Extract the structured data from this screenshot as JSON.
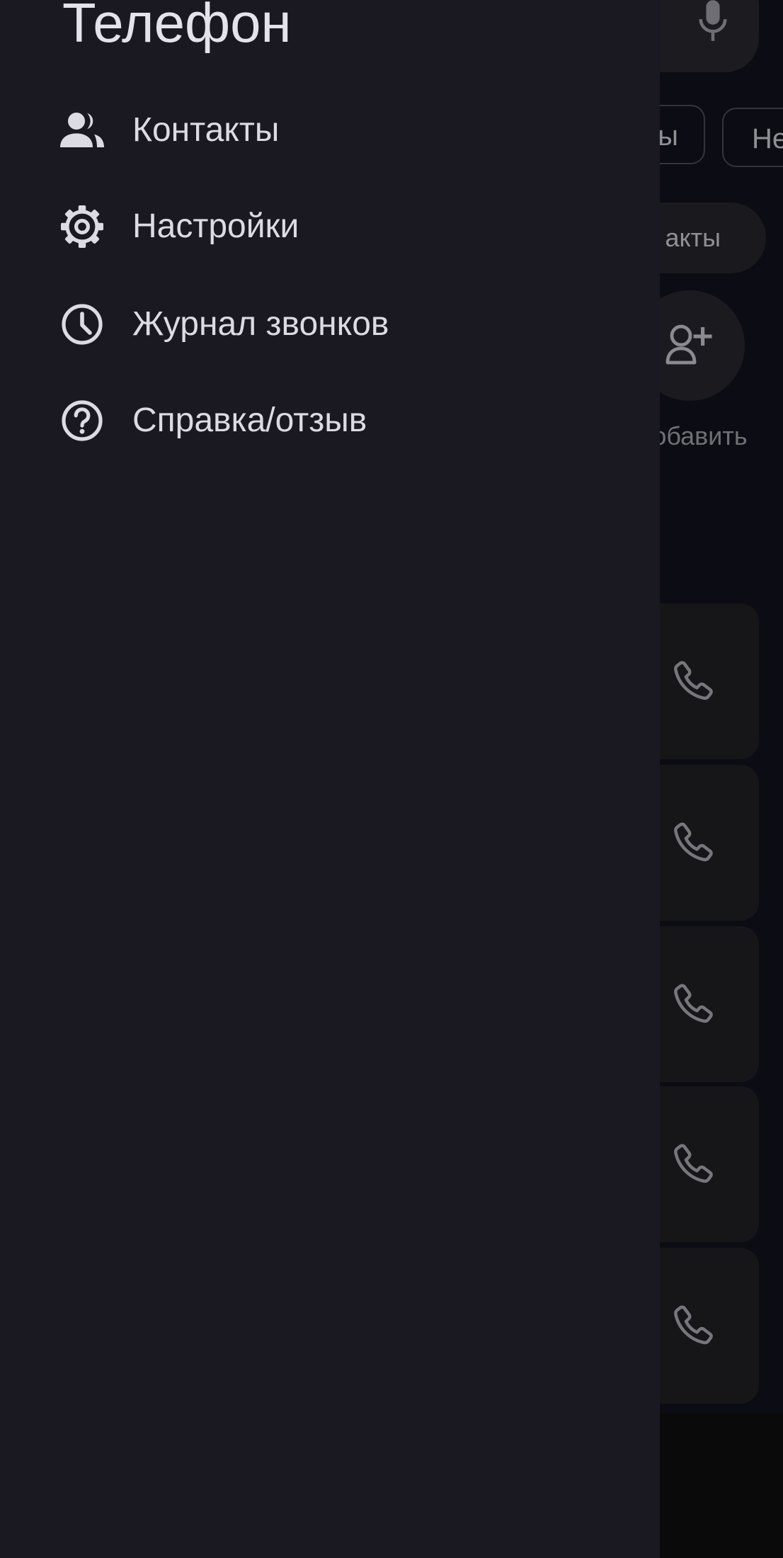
{
  "drawer": {
    "title": "Телефон",
    "items": [
      {
        "label": "Контакты",
        "icon": "contacts-icon"
      },
      {
        "label": "Настройки",
        "icon": "gear-icon"
      },
      {
        "label": "Журнал звонков",
        "icon": "clock-icon"
      },
      {
        "label": "Справка/отзыв",
        "icon": "help-icon"
      }
    ]
  },
  "background": {
    "chip_1": "ы",
    "chip_2": "Не",
    "pill": "акты",
    "add_label": "добавить"
  },
  "colors": {
    "drawer_bg": "#1a1922",
    "text": "#dcdae2",
    "scrim_bg": "#0c0c14"
  }
}
